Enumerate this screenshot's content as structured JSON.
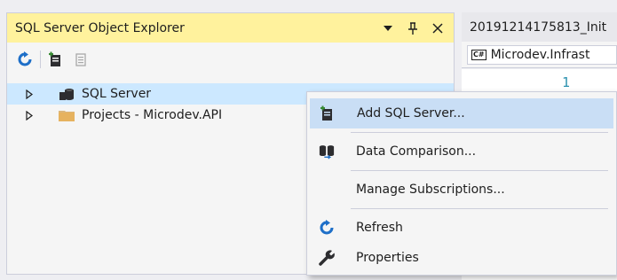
{
  "tool_window": {
    "title": "SQL Server Object Explorer",
    "title_icons": [
      "dropdown-icon",
      "pin-icon",
      "close-icon"
    ],
    "toolbar": [
      "refresh-icon",
      "add-sql-server-icon",
      "disabled-filter-icon"
    ]
  },
  "tree": {
    "items": [
      {
        "label": "SQL Server",
        "icon": "sql-server-icon",
        "expanded": false,
        "selected": true
      },
      {
        "label": "Projects - Microdev.API",
        "icon": "folder-icon",
        "expanded": false,
        "selected": false
      }
    ]
  },
  "document": {
    "tab_title": "20191214175813_Init",
    "nav_badge": "C#",
    "nav_label": "Microdev.Infrast",
    "line_number": "1"
  },
  "context_menu": {
    "items": [
      {
        "label": "Add SQL Server...",
        "icon": "add-sql-server-icon",
        "highlighted": true
      },
      {
        "label": "Data Comparison...",
        "icon": "data-comparison-icon",
        "highlighted": false
      },
      {
        "label": "Manage Subscriptions...",
        "icon": "",
        "highlighted": false
      },
      {
        "label": "Refresh",
        "icon": "refresh-icon",
        "highlighted": false
      },
      {
        "label": "Properties",
        "icon": "wrench-icon",
        "highlighted": false
      }
    ]
  },
  "colors": {
    "title_bar": "#fff29d",
    "selection": "#cce8ff",
    "menu_highlight": "#c9def5",
    "refresh_blue": "#1e6fc8",
    "folder": "#dcb67a"
  }
}
